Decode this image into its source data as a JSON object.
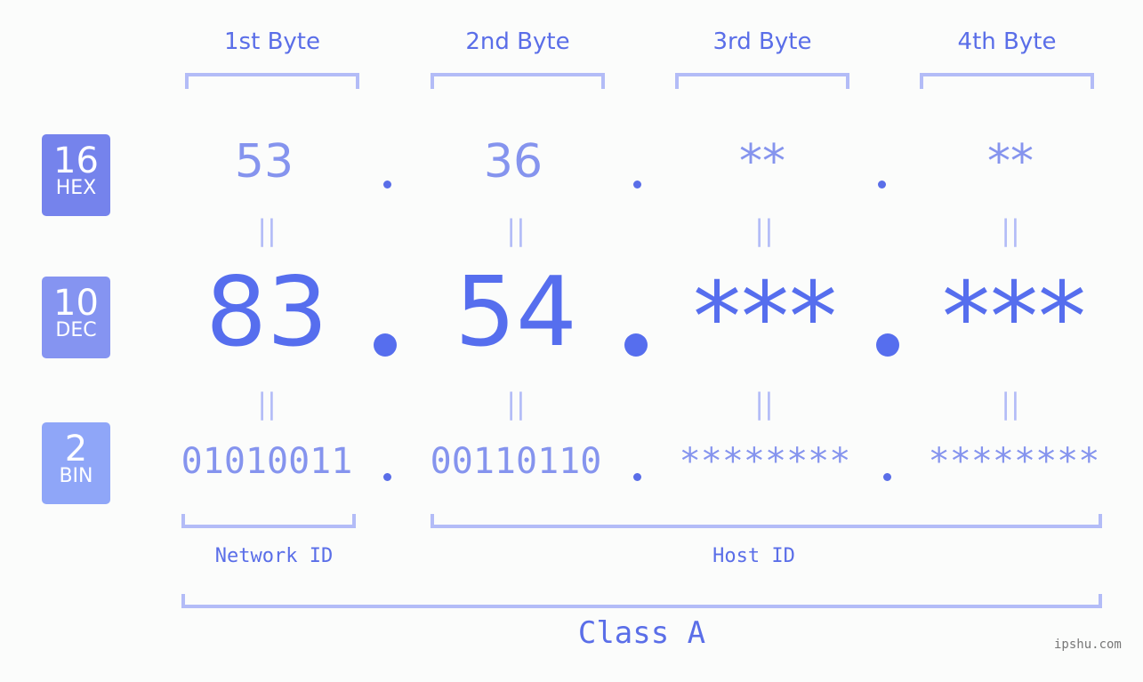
{
  "bytes": [
    {
      "header": "1st Byte",
      "hex": "53",
      "dec": "83",
      "bin": "01010011"
    },
    {
      "header": "2nd Byte",
      "hex": "36",
      "dec": "54",
      "bin": "00110110"
    },
    {
      "header": "3rd Byte",
      "hex": "**",
      "dec": "***",
      "bin": "********"
    },
    {
      "header": "4th Byte",
      "hex": "**",
      "dec": "***",
      "bin": "********"
    }
  ],
  "badges": {
    "hex": {
      "num": "16",
      "label": "HEX",
      "color": "#7583ec"
    },
    "dec": {
      "num": "10",
      "label": "DEC",
      "color": "#8594f1"
    },
    "bin": {
      "num": "2",
      "label": "BIN",
      "color": "#8fa6f8"
    }
  },
  "equals_sign": "||",
  "network_id_label": "Network ID",
  "host_id_label": "Host ID",
  "class_label": "Class A",
  "watermark": "ipshu.com",
  "colors": {
    "accent": "#566eee",
    "light": "#8594ee",
    "bracket": "#b3bcf7"
  }
}
